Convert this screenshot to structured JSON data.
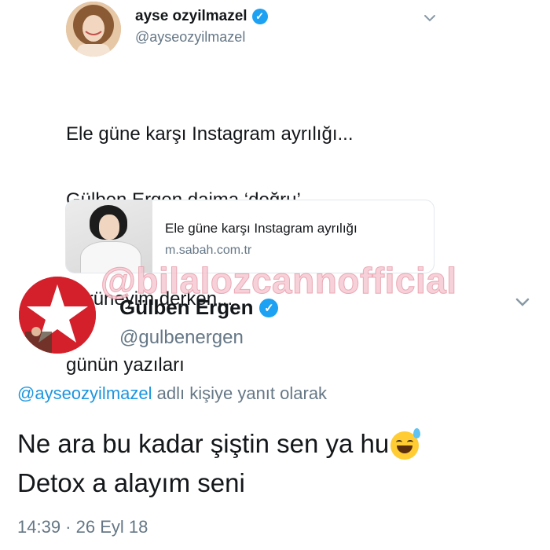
{
  "tweet1": {
    "name": "ayse ozyilmazel",
    "handle": "@ayseozyilmazel",
    "text_lines": [
      "Ele güne karşı Instagram ayrılığı...",
      "Gülben Ergen daima ‘doğru’",
      "görüneyim derken...",
      "günün yazıları"
    ],
    "pointing_emoji": "👉🏼",
    "card": {
      "title": "Ele güne karşı Instagram ayrılığı",
      "url": "m.sabah.com.tr"
    }
  },
  "watermark": "@bilalozcannofficial",
  "tweet2": {
    "name": "Gülben Ergen",
    "handle": "@gulbenergen",
    "reply_prefix": "@ayseozyilmazel",
    "reply_suffix": "adlı kişiye yanıt olarak",
    "line1": "Ne ara bu kadar şiştin sen ya hu",
    "line2": "Detox a alayım seni",
    "timestamp": "14:39 · 26 Eyl 18"
  },
  "colors": {
    "verified": "#1da1f2",
    "secondary_text": "#657786",
    "mention": "#1b95e0",
    "avatar2_bg": "#d3202b",
    "watermark": "#f6c9d3"
  },
  "icons": [
    "verified-badge-icon",
    "chevron-down-icon",
    "grinning-sweat-emoji-icon",
    "pointing-hand-emoji-icon"
  ]
}
